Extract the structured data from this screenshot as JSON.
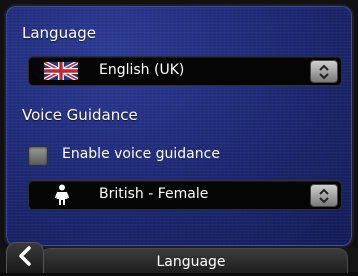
{
  "language_section": {
    "label": "Language",
    "selected_value": "English (UK)",
    "flag_icon": "uk-flag-icon"
  },
  "voice_section": {
    "label": "Voice Guidance",
    "enable_checkbox_label": "Enable voice guidance",
    "enable_checked": false,
    "selected_voice": "British - Female",
    "voice_icon": "female-person-icon"
  },
  "footer": {
    "title": "Language",
    "back_icon": "chevron-left-icon"
  },
  "colors": {
    "panel_bg": "#1c2772",
    "select_bg": "#050505",
    "text": "#ffffff"
  }
}
